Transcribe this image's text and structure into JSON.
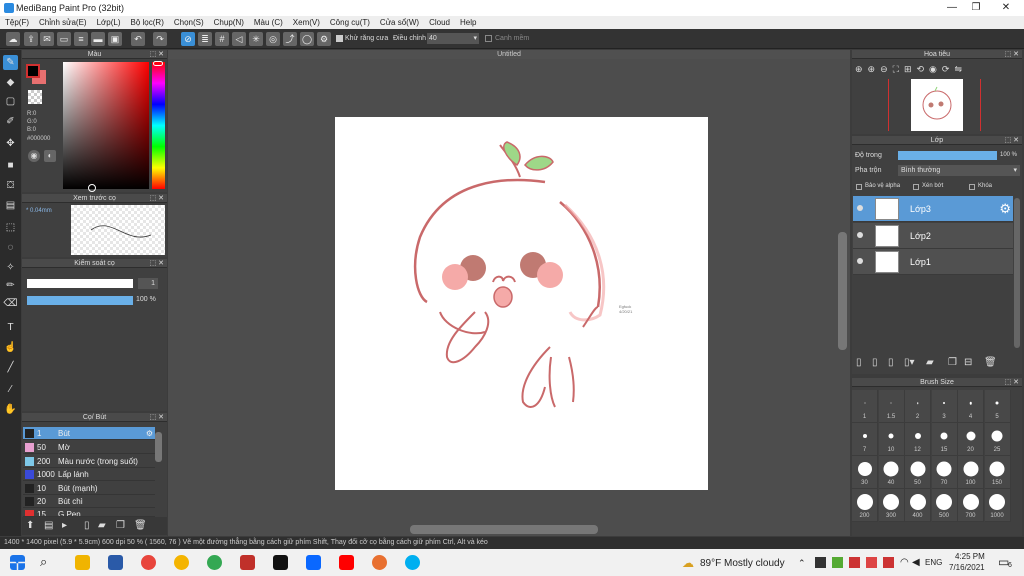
{
  "app": {
    "title": "MediBang Paint Pro (32bit)"
  },
  "menu": [
    "Tệp(F)",
    "Chỉnh sửa(E)",
    "Lớp(L)",
    "Bộ lọc(R)",
    "Chọn(S)",
    "Chụp(N)",
    "Màu (C)",
    "Xem(V)",
    "Công cụ(T)",
    "Cửa sổ(W)",
    "Cloud",
    "Help"
  ],
  "toolbar": {
    "antialias_label": "Khử răng cưa",
    "adjust_label": "Điều chỉnh",
    "adjust_value": "40",
    "snap_label": "Canh mềm"
  },
  "panels": {
    "color": {
      "title": "Màu",
      "r": "R:0",
      "g": "G:0",
      "b": "B:0",
      "hex": "#000000"
    },
    "brush_preview": {
      "title": "Xem trước cọ",
      "size": "0.04mm"
    },
    "brush_ctrl": {
      "title": "Kiểm soát cọ",
      "size_value": "1",
      "opacity": "100 %"
    },
    "brushes": {
      "title": "Cọ/ Bút",
      "items": [
        {
          "size": "1",
          "name": "Bút",
          "color": "#222222"
        },
        {
          "size": "50",
          "name": "Mờ",
          "color": "#e8a0d0"
        },
        {
          "size": "200",
          "name": "Màu nước (trong suốt)",
          "color": "#7ec8e8"
        },
        {
          "size": "1000",
          "name": "Lấp lánh",
          "color": "#3a4ad8"
        },
        {
          "size": "10",
          "name": "Bút (mạnh)",
          "color": "#222222"
        },
        {
          "size": "20",
          "name": "Bút chì",
          "color": "#222222"
        },
        {
          "size": "15",
          "name": "G Pen",
          "color": "#e03030"
        }
      ]
    },
    "navigator": {
      "title": "Hoa tiêu"
    },
    "layer": {
      "title": "Lớp",
      "opacity_label": "Độ trong",
      "opacity_value": "100 %",
      "blend_label": "Pha trộn",
      "blend_value": "Bình thường",
      "protect_alpha": "Bảo vệ alpha",
      "clip": "Xén bớt",
      "lock": "Khóa",
      "layers": [
        {
          "name": "Lớp3"
        },
        {
          "name": "Lớp2"
        },
        {
          "name": "Lớp1"
        }
      ]
    },
    "brush_size": {
      "title": "Brush Size",
      "sizes": [
        "1",
        "1.5",
        "2",
        "3",
        "4",
        "5",
        "7",
        "10",
        "12",
        "15",
        "20",
        "25",
        "30",
        "40",
        "50",
        "70",
        "100",
        "150",
        "200",
        "300",
        "400",
        "500",
        "700",
        "1000"
      ]
    }
  },
  "canvas": {
    "title": "Untitled",
    "signature": "Egfuck\n4/20/21"
  },
  "status": {
    "text": "1400 * 1400 pixel   (5.9 * 5.9cm)  600 dpi   50 %   ( 1560, 76 )   Vẽ một đường thẳng bằng cách giữ phím Shift, Thay đổi cỡ cọ bằng cách giữ phím Ctrl, Alt và kéo"
  },
  "taskbar": {
    "weather": "89°F  Mostly cloudy",
    "lang": "ENG",
    "time": "4:25 PM",
    "date": "7/16/2021",
    "notif": "6"
  },
  "colors": {
    "accent": "#3a8fd6",
    "sprout": "#8fd47a",
    "outline": "#c9696a",
    "cheek": "#f2a0a0",
    "eye": "#c07a72"
  }
}
